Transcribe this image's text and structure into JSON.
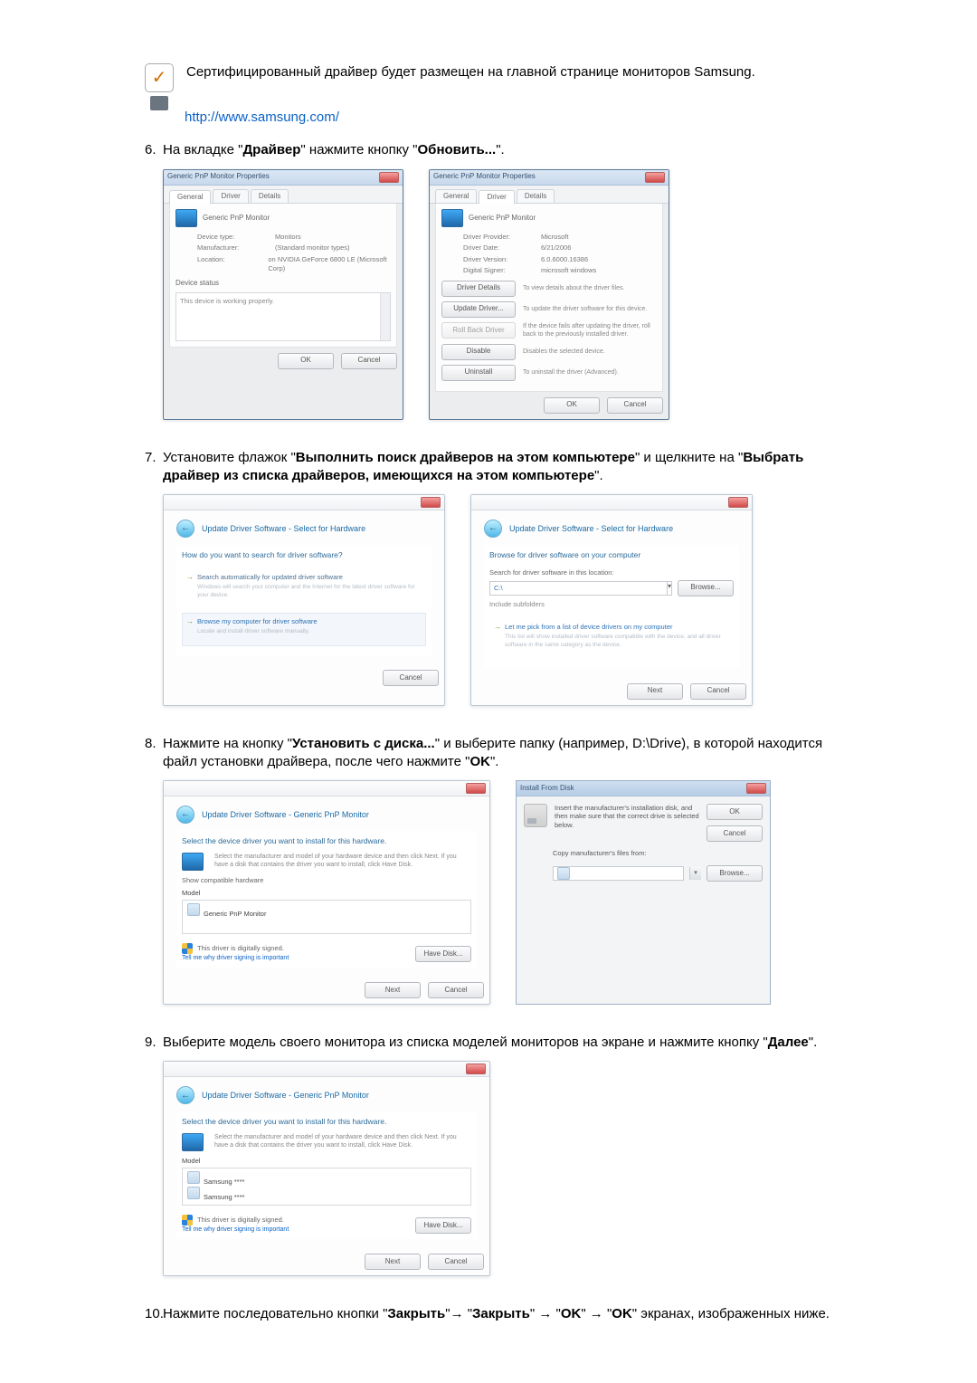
{
  "intro": {
    "text": "Сертифицированный драйвер будет размещен на главной странице мониторов Samsung.",
    "url": "http://www.samsung.com/"
  },
  "steps": {
    "6": {
      "pre": "На вкладке \"",
      "b1": "Драйвер",
      "mid": "\" нажмите кнопку \"",
      "b2": "Обновить...",
      "post": "\"."
    },
    "7": {
      "pre": "Установите флажок \"",
      "b1": "Выполнить поиск драйверов на этом компьютере",
      "mid1": "\" и щелкните на \"",
      "b2": "Выбрать драйвер из списка драйверов, имеющихся на этом компьютере",
      "post": "\"."
    },
    "8": {
      "pre": "Нажмите на кнопку \"",
      "b1": "Установить с диска...",
      "mid1": "\" и выберите папку (например, D:\\Drive), в которой находится файл установки драйвера, после чего нажмите \"",
      "b2": "OK",
      "post": "\"."
    },
    "9": {
      "pre": "Выберите модель своего монитора из списка моделей мониторов на экране и нажмите кнопку \"",
      "b1": "Далее",
      "post": "\"."
    },
    "10": {
      "pre": "Нажмите последовательно кнопки \"",
      "b1": "Закрыть",
      "mid1": "\"→ \"",
      "b2": "Закрыть",
      "mid2": "\" → \"",
      "b3": "OK",
      "mid3": "\" → \"",
      "b4": "OK",
      "post": "\" экранах, изображенных ниже."
    }
  },
  "dlg6a": {
    "title": "Generic PnP Monitor Properties",
    "tab_general": "General",
    "tab_driver": "Driver",
    "tab_details": "Details",
    "heading": "Generic PnP Monitor",
    "k1": "Device type:",
    "v1": "Monitors",
    "k2": "Manufacturer:",
    "v2": "(Standard monitor types)",
    "k3": "Location:",
    "v3": "on NVIDIA GeForce 6800 LE (Microsoft Corp)",
    "status_label": "Device status",
    "status_text": "This device is working properly.",
    "btn_ok": "OK",
    "btn_cancel": "Cancel"
  },
  "dlg6b": {
    "title": "Generic PnP Monitor Properties",
    "tab_general": "General",
    "tab_driver": "Driver",
    "tab_details": "Details",
    "heading": "Generic PnP Monitor",
    "k1": "Driver Provider:",
    "v1": "Microsoft",
    "k2": "Driver Date:",
    "v2": "6/21/2006",
    "k3": "Driver Version:",
    "v3": "6.0.6000.16386",
    "k4": "Digital Signer:",
    "v4": "microsoft windows",
    "btn_details": "Driver Details",
    "txt_details": "To view details about the driver files.",
    "btn_update": "Update Driver...",
    "txt_update": "To update the driver software for this device.",
    "btn_rollback": "Roll Back Driver",
    "txt_rollback": "If the device fails after updating the driver, roll back to the previously installed driver.",
    "btn_disable": "Disable",
    "txt_disable": "Disables the selected device.",
    "btn_uninstall": "Uninstall",
    "txt_uninstall": "To uninstall the driver (Advanced).",
    "btn_ok": "OK",
    "btn_cancel": "Cancel"
  },
  "dlg7a": {
    "bread": "Update Driver Software - Select for Hardware",
    "h": "How do you want to search for driver software?",
    "opt1": "Search automatically for updated driver software",
    "opt1_sub": "Windows will search your computer and the Internet for the latest driver software for your device.",
    "opt2": "Browse my computer for driver software",
    "opt2_sub": "Locate and install driver software manually.",
    "btn_cancel": "Cancel"
  },
  "dlg7b": {
    "bread": "Update Driver Software - Select for Hardware",
    "h": "Browse for driver software on your computer",
    "lbl": "Search for driver software in this location:",
    "path": "C:\\",
    "btn_browse": "Browse...",
    "chk": "Include subfolders",
    "opt": "Let me pick from a list of device drivers on my computer",
    "opt_sub": "This list will show installed driver software compatible with the device, and all driver software in the same category as the device.",
    "btn_next": "Next",
    "btn_cancel": "Cancel"
  },
  "dlg8a": {
    "bread": "Update Driver Software - Generic PnP Monitor",
    "h": "Select the device driver you want to install for this hardware.",
    "hint": "Select the manufacturer and model of your hardware device and then click Next. If you have a disk that contains the driver you want to install, click Have Disk.",
    "chk": "Show compatible hardware",
    "model_hdr": "Model",
    "model_item": "Generic PnP Monitor",
    "sign1": "This driver is digitally signed.",
    "sign2": "Tell me why driver signing is important",
    "btn_have": "Have Disk...",
    "btn_next": "Next",
    "btn_cancel": "Cancel"
  },
  "dlg8b": {
    "title": "Install From Disk",
    "txt": "Insert the manufacturer's installation disk, and then make sure that the correct drive is selected below.",
    "btn_ok": "OK",
    "btn_cancel": "Cancel",
    "lbl": "Copy manufacturer's files from:",
    "btn_browse": "Browse..."
  },
  "dlg9": {
    "bread": "Update Driver Software - Generic PnP Monitor",
    "h": "Select the device driver you want to install for this hardware.",
    "hint": "Select the manufacturer and model of your hardware device and then click Next. If you have a disk that contains the driver you want to install, click Have Disk.",
    "model_hdr": "Model",
    "model_item1": "Samsung ****",
    "model_item2": "Samsung ****",
    "sign1": "This driver is digitally signed.",
    "sign2": "Tell me why driver signing is important",
    "btn_have": "Have Disk...",
    "btn_next": "Next",
    "btn_cancel": "Cancel"
  }
}
